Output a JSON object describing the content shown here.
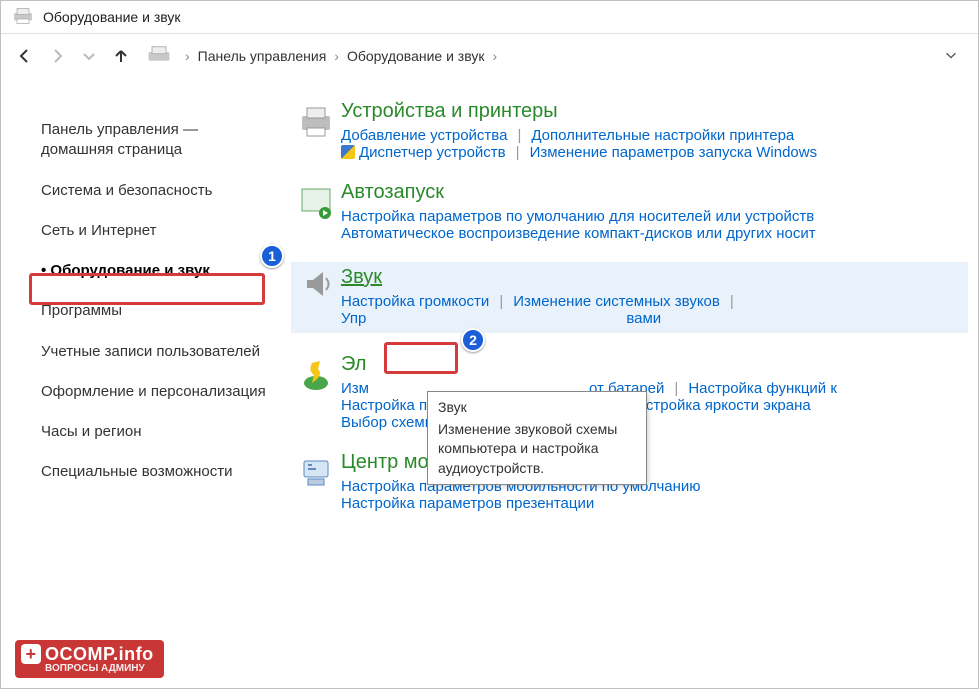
{
  "window": {
    "title": "Оборудование и звук"
  },
  "breadcrumb": {
    "items": [
      "Панель управления",
      "Оборудование и звук"
    ]
  },
  "sidebar": {
    "items": [
      {
        "label": "Панель управления — домашняя страница",
        "key": "home"
      },
      {
        "label": "Система и безопасность",
        "key": "system"
      },
      {
        "label": "Сеть и Интернет",
        "key": "network"
      },
      {
        "label": "Оборудование и звук",
        "key": "hardware",
        "active": true
      },
      {
        "label": "Программы",
        "key": "programs"
      },
      {
        "label": "Учетные записи пользователей",
        "key": "accounts"
      },
      {
        "label": "Оформление и персонализация",
        "key": "appearance"
      },
      {
        "label": "Часы и регион",
        "key": "clock"
      },
      {
        "label": "Специальные возможности",
        "key": "ease"
      }
    ]
  },
  "sections": {
    "devices": {
      "title": "Устройства и принтеры",
      "links": [
        "Добавление устройства",
        "Дополнительные настройки принтера",
        "Диспетчер устройств",
        "Изменение параметров запуска Windows"
      ],
      "shielded": [
        2
      ]
    },
    "autoplay": {
      "title": "Автозапуск",
      "links": [
        "Настройка параметров по умолчанию для носителей или устройств",
        "Автоматическое воспроизведение компакт-дисков или других носит"
      ]
    },
    "sound": {
      "title": "Звук",
      "links": [
        "Настройка громкости",
        "Изменение системных звуков",
        "Упр",
        "вами"
      ]
    },
    "power": {
      "title": "Эл",
      "links_row1": [
        "Изм",
        "от батарей",
        "Настройка функций к"
      ],
      "links_row2": [
        "Настройка перехода в спящий режим",
        "Настройка яркости экрана"
      ],
      "links_row3": [
        "Выбор схемы управления питанием"
      ]
    },
    "mobility": {
      "title": "Центр мобильности Windows",
      "links": [
        "Настройка параметров мобильности по умолчанию",
        "Настройка параметров презентации"
      ]
    }
  },
  "tooltip": {
    "title": "Звук",
    "body": "Изменение звуковой схемы компьютера и настройка аудиоустройств."
  },
  "annotations": {
    "badge1": "1",
    "badge2": "2"
  },
  "watermark": {
    "brand": "OCOMP.info",
    "sub": "ВОПРОСЫ АДМИНУ"
  }
}
